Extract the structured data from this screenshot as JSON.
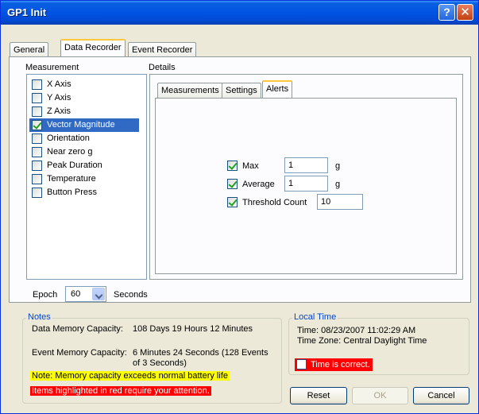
{
  "window": {
    "title": "GP1 Init",
    "help_icon": "?",
    "close_icon": "✕"
  },
  "tabs": [
    "General",
    "Data Recorder",
    "Event Recorder"
  ],
  "measurement": {
    "label": "Measurement",
    "items": [
      {
        "label": "X Axis",
        "checked": false
      },
      {
        "label": "Y Axis",
        "checked": false
      },
      {
        "label": "Z Axis",
        "checked": false
      },
      {
        "label": "Vector Magnitude",
        "checked": true
      },
      {
        "label": "Orientation",
        "checked": false
      },
      {
        "label": "Near zero g",
        "checked": false
      },
      {
        "label": "Peak Duration",
        "checked": false
      },
      {
        "label": "Temperature",
        "checked": false
      },
      {
        "label": "Button Press",
        "checked": false
      }
    ]
  },
  "details": {
    "label": "Details",
    "tabs": [
      "Measurements",
      "Settings",
      "Alerts"
    ],
    "alerts": {
      "max": {
        "label": "Max",
        "checked": true,
        "value": "1",
        "unit": "g"
      },
      "average": {
        "label": "Average",
        "checked": true,
        "value": "1",
        "unit": "g"
      },
      "threshold": {
        "label": "Threshold Count",
        "checked": true,
        "value": "10"
      }
    }
  },
  "epoch": {
    "label": "Epoch",
    "value": "60",
    "unit": "Seconds"
  },
  "notes": {
    "title": "Notes",
    "data_memory_label": "Data Memory Capacity:",
    "data_memory_value": "108 Days 19 Hours 12 Minutes",
    "event_memory_label": "Event Memory Capacity:",
    "event_memory_value_line1": "6 Minutes 24 Seconds (128 Events",
    "event_memory_value_line2": "of 3 Seconds)",
    "warning_yellow": "Note: Memory capacity exceeds normal battery life",
    "warning_red": "Items highlighted in red require your attention."
  },
  "local_time": {
    "title": "Local Time",
    "time": "Time: 08/23/2007 11:02:29 AM",
    "zone": "Time Zone: Central Daylight Time",
    "confirm_label": "Time is correct.",
    "confirm_checked": false
  },
  "buttons": {
    "reset": "Reset",
    "ok": "OK",
    "cancel": "Cancel"
  },
  "colors": {
    "title_bar": "#0054e3",
    "selection": "#316ac5",
    "warning_yellow": "#ffff00",
    "warning_red": "#ff0000",
    "group_title": "#0046d5"
  }
}
